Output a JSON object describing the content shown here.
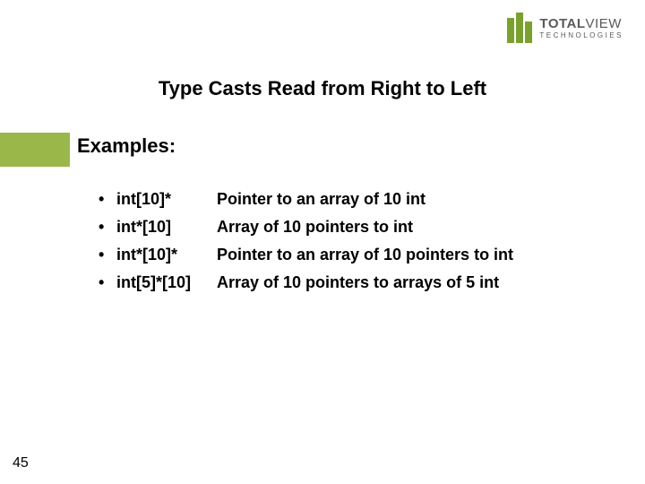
{
  "logo": {
    "line1_strong": "TOTAL",
    "line1_thin": "VIEW",
    "line2": "TECHNOLOGIES"
  },
  "title": "Type Casts Read from Right to Left",
  "subtitle": "Examples:",
  "items": [
    {
      "code": "int[10]*",
      "desc": "Pointer to an array of 10 int"
    },
    {
      "code": "int*[10]",
      "desc": "Array of 10 pointers to int"
    },
    {
      "code": "int*[10]*",
      "desc": "Pointer to an array of 10 pointers to int"
    },
    {
      "code": "int[5]*[10]",
      "desc": "Array of 10 pointers to arrays of 5 int"
    }
  ],
  "page_number": "45"
}
